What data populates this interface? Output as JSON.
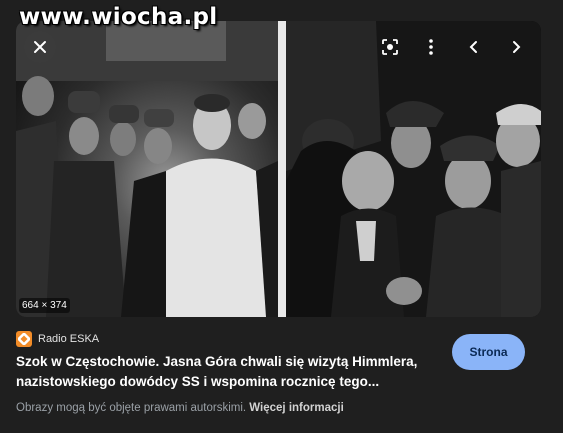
{
  "watermark": "www.wiocha.pl",
  "preview": {
    "dimensions": "664 × 374",
    "toolbar_icons": [
      "lens-icon",
      "more-vert-icon",
      "chevron-left-icon",
      "chevron-right-icon"
    ]
  },
  "result": {
    "source_name": "Radio ESKA",
    "favicon_icon": "radio-eska-favicon",
    "title_line1": "Szok w Częstochowie. Jasna Góra chwali się wizytą Himmlera,",
    "title_line2": "nazistowskiego dowódcy SS i wspomina rocznicę tego...",
    "visit_label": "Strona",
    "copyright_text": "Obrazy mogą być objęte prawami autorskimi.",
    "more_info_label": "Więcej informacji"
  },
  "colors": {
    "background": "#1f1f1f",
    "accent_button": "#8ab4f8",
    "favicon": "#f28c28"
  }
}
